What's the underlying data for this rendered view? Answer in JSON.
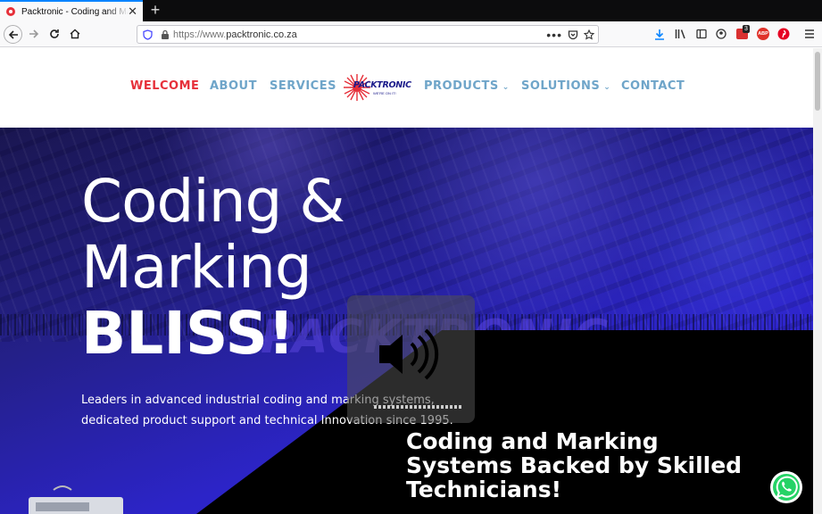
{
  "browser": {
    "tab_title": "Packtronic - Coding and Marking",
    "url_prefix": "https://www.",
    "url_domain": "packtronic.co.za",
    "ext_badge": "3",
    "abp_label": "ABP"
  },
  "nav": {
    "items": [
      {
        "label": "WELCOME",
        "active": true
      },
      {
        "label": "ABOUT"
      },
      {
        "label": "SERVICES"
      },
      {
        "label": "PRODUCTS",
        "dropdown": true
      },
      {
        "label": "SOLUTIONS",
        "dropdown": true
      },
      {
        "label": "CONTACT"
      }
    ],
    "logo_text": "PACKTRONIC",
    "logo_tagline": "WE'RE ON IT!"
  },
  "hero": {
    "title_line1": "Coding &",
    "title_line2": "Marking",
    "title_line3": "BLISS!",
    "subtitle": "Leaders in advanced industrial coding and marking systems, dedicated product support and technical Innovation since 1995.",
    "heading2": "Coding and Marking Systems Backed by Skilled Technicians!",
    "watermark": "PACKTRONIC"
  },
  "colors": {
    "nav_text": "#6fa5c9",
    "nav_active": "#e6303a",
    "whatsapp": "#25d366",
    "hero_blue": "#2c24c8"
  },
  "icons": {
    "whatsapp": "whatsapp-icon",
    "speaker": "speaker-icon"
  }
}
